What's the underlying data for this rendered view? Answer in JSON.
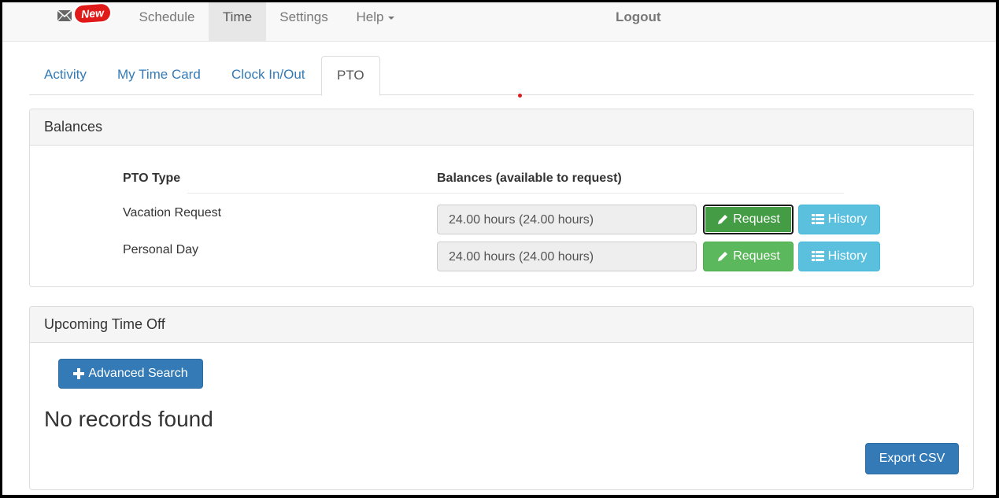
{
  "navbar": {
    "new_badge": "New",
    "items": [
      {
        "label": "Schedule"
      },
      {
        "label": "Time"
      },
      {
        "label": "Settings"
      },
      {
        "label": "Help"
      }
    ],
    "logout": "Logout"
  },
  "tabs": [
    {
      "label": "Activity"
    },
    {
      "label": "My Time Card"
    },
    {
      "label": "Clock In/Out"
    },
    {
      "label": "PTO"
    }
  ],
  "balances": {
    "title": "Balances",
    "col_type": "PTO Type",
    "col_balance": "Balances (available to request)",
    "rows": [
      {
        "type": "Vacation Request",
        "balance": "24.00 hours (24.00 hours)",
        "request": "Request",
        "history": "History"
      },
      {
        "type": "Personal Day",
        "balance": "24.00 hours (24.00 hours)",
        "request": "Request",
        "history": "History"
      }
    ]
  },
  "upcoming": {
    "title": "Upcoming Time Off",
    "advanced_search": "Advanced Search",
    "empty": "No records found",
    "export": "Export CSV"
  },
  "colors": {
    "success": "#5cb85c",
    "info": "#5bc0de",
    "primary": "#337ab7",
    "badge": "#e01919"
  }
}
